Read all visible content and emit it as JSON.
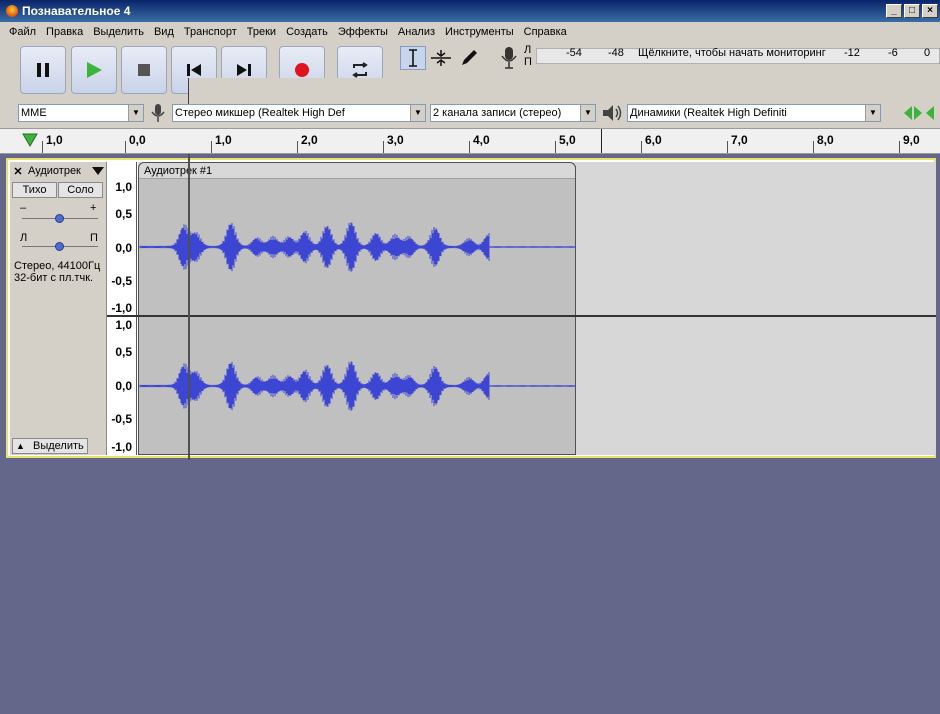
{
  "window": {
    "title": "Познавательное 4"
  },
  "menu": [
    "Файл",
    "Правка",
    "Выделить",
    "Вид",
    "Транспорт",
    "Треки",
    "Создать",
    "Эффекты",
    "Анализ",
    "Инструменты",
    "Справка"
  ],
  "meter": {
    "lr_top": "Л",
    "lr_bottom": "П",
    "db": [
      "-54",
      "-48",
      "-12",
      "-6",
      "0"
    ],
    "monitor_prompt": "Щёлкните, чтобы начать мониторинг"
  },
  "devices": {
    "host": "MME",
    "record_device": "Стерео микшер (Realtek High Def",
    "channels": "2  канала записи (стерео)",
    "playback_device": "Динамики (Realtek High Definiti"
  },
  "timeline": {
    "ticks": [
      "1,0",
      "0,0",
      "1,0",
      "2,0",
      "3,0",
      "4,0",
      "5,0",
      "6,0",
      "7,0",
      "8,0",
      "9,0"
    ]
  },
  "track": {
    "name": "Аудиотрек",
    "mute": "Тихо",
    "solo": "Соло",
    "gain_minus": "–",
    "gain_plus": "+",
    "pan_left": "Л",
    "pan_right": "П",
    "info_line1": "Стерео, 44100Гц",
    "info_line2": "32-бит с пл.тчк.",
    "select": "Выделить",
    "clip_name": "Аудиотрек #1",
    "scale": [
      "1,0",
      "0,5",
      "0,0",
      "-0,5",
      "-1,0"
    ]
  },
  "colors": {
    "wave": "#3c46d2",
    "record": "#e0141e",
    "play": "#3cb43c",
    "selection_border": "#e6e26a"
  }
}
